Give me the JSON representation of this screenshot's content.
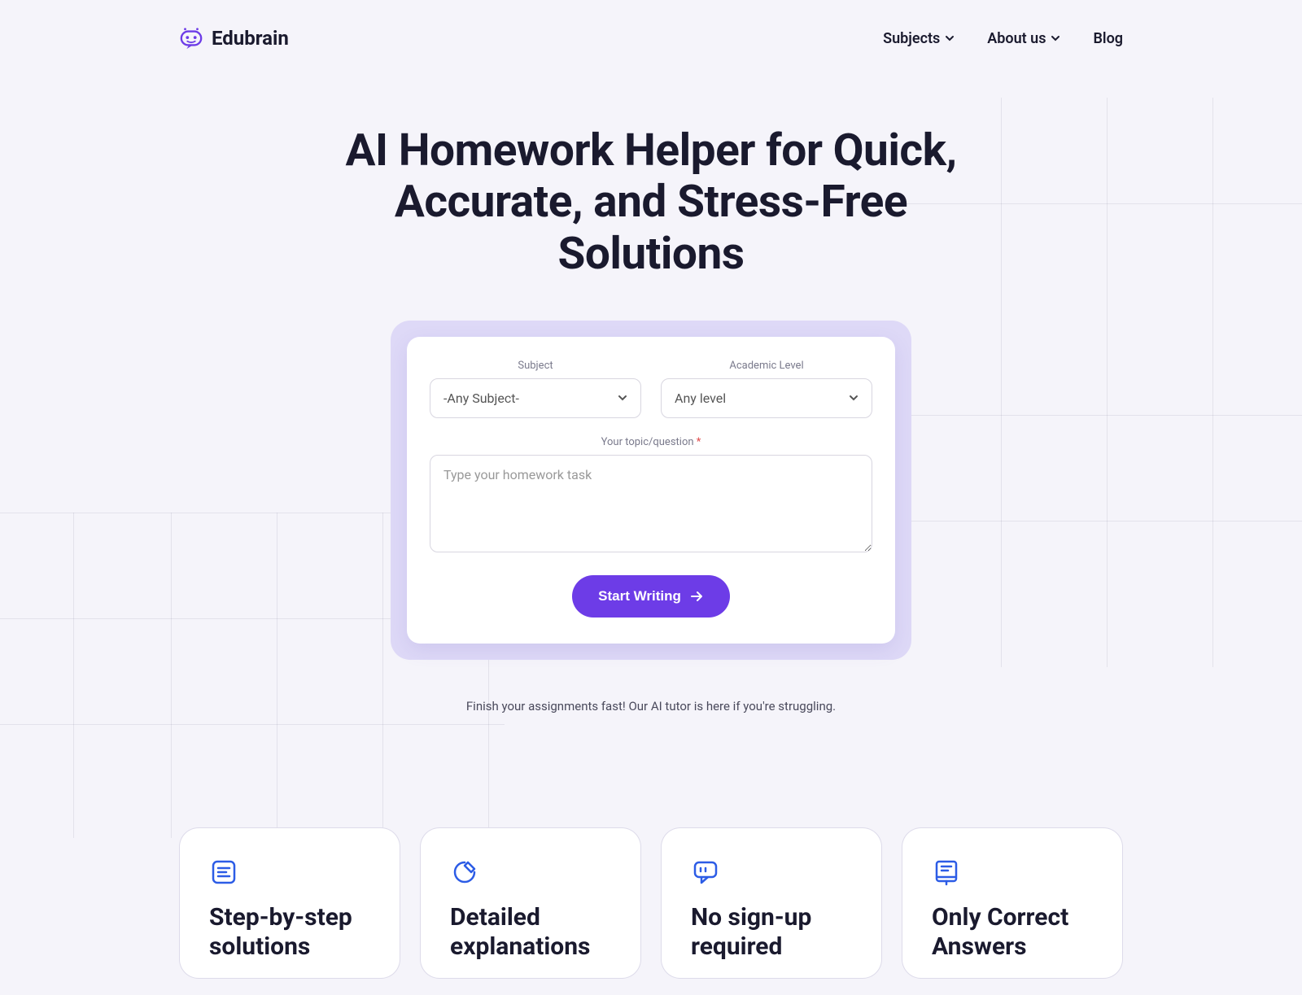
{
  "brand": {
    "name": "Edubrain"
  },
  "nav": {
    "subjects": "Subjects",
    "about": "About us",
    "blog": "Blog"
  },
  "hero": {
    "title": "AI Homework Helper for Quick, Accurate, and Stress-Free Solutions"
  },
  "form": {
    "subject_label": "Subject",
    "subject_value": "-Any Subject-",
    "level_label": "Academic Level",
    "level_value": "Any level",
    "question_label": "Your topic/question",
    "question_placeholder": "Type your homework task",
    "submit": "Start Writing"
  },
  "subtext": "Finish your assignments fast! Our AI tutor is here if you're struggling.",
  "features": [
    {
      "title": "Step-by-step solutions"
    },
    {
      "title": "Detailed explanations"
    },
    {
      "title": "No sign-up required"
    },
    {
      "title": "Only Correct Answers"
    }
  ]
}
